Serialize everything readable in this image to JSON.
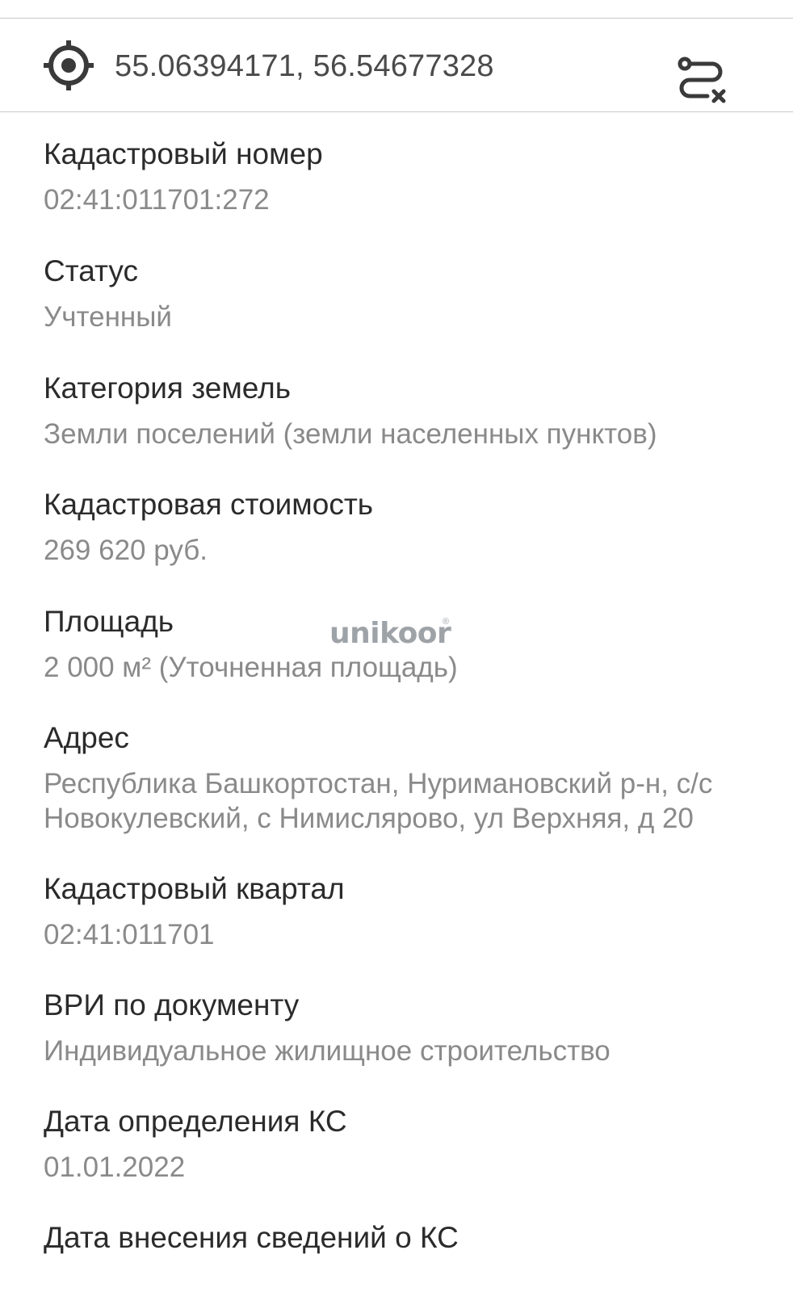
{
  "header": {
    "locate_icon": "crosshair-locate-icon",
    "coordinates": "55.06394171, 56.54677328",
    "route_clear_icon": "route-clear-icon"
  },
  "fields": [
    {
      "label": "Кадастровый номер",
      "value": "02:41:011701:272"
    },
    {
      "label": "Статус",
      "value": "Учтенный"
    },
    {
      "label": "Категория земель",
      "value": "Земли поселений (земли населенных пунктов)"
    },
    {
      "label": "Кадастровая стоимость",
      "value": "269 620 руб."
    },
    {
      "label": "Площадь",
      "value": "2 000 м² (Уточненная площадь)"
    },
    {
      "label": "Адрес",
      "value_lines": [
        "Республика Башкортостан, Нуримановский р-н, с/с",
        "Новокулевский, с Нимисляро­во, ул Верхняя, д 20"
      ]
    },
    {
      "label": "Кадастровый квартал",
      "value": "02:41:011701"
    },
    {
      "label": "ВРИ по документу",
      "value": "Индивидуальное жилищное строительство"
    },
    {
      "label": "Дата определения КС",
      "value": "01.01.2022"
    },
    {
      "label": "Дата внесения сведений о КС"
    }
  ],
  "watermark": {
    "text": "unikoor",
    "mark": "®"
  },
  "colors": {
    "label": "#2b2b2b",
    "value": "#8a8a8a",
    "divider": "#c8c8c8",
    "icon": "#3a3a3a"
  }
}
